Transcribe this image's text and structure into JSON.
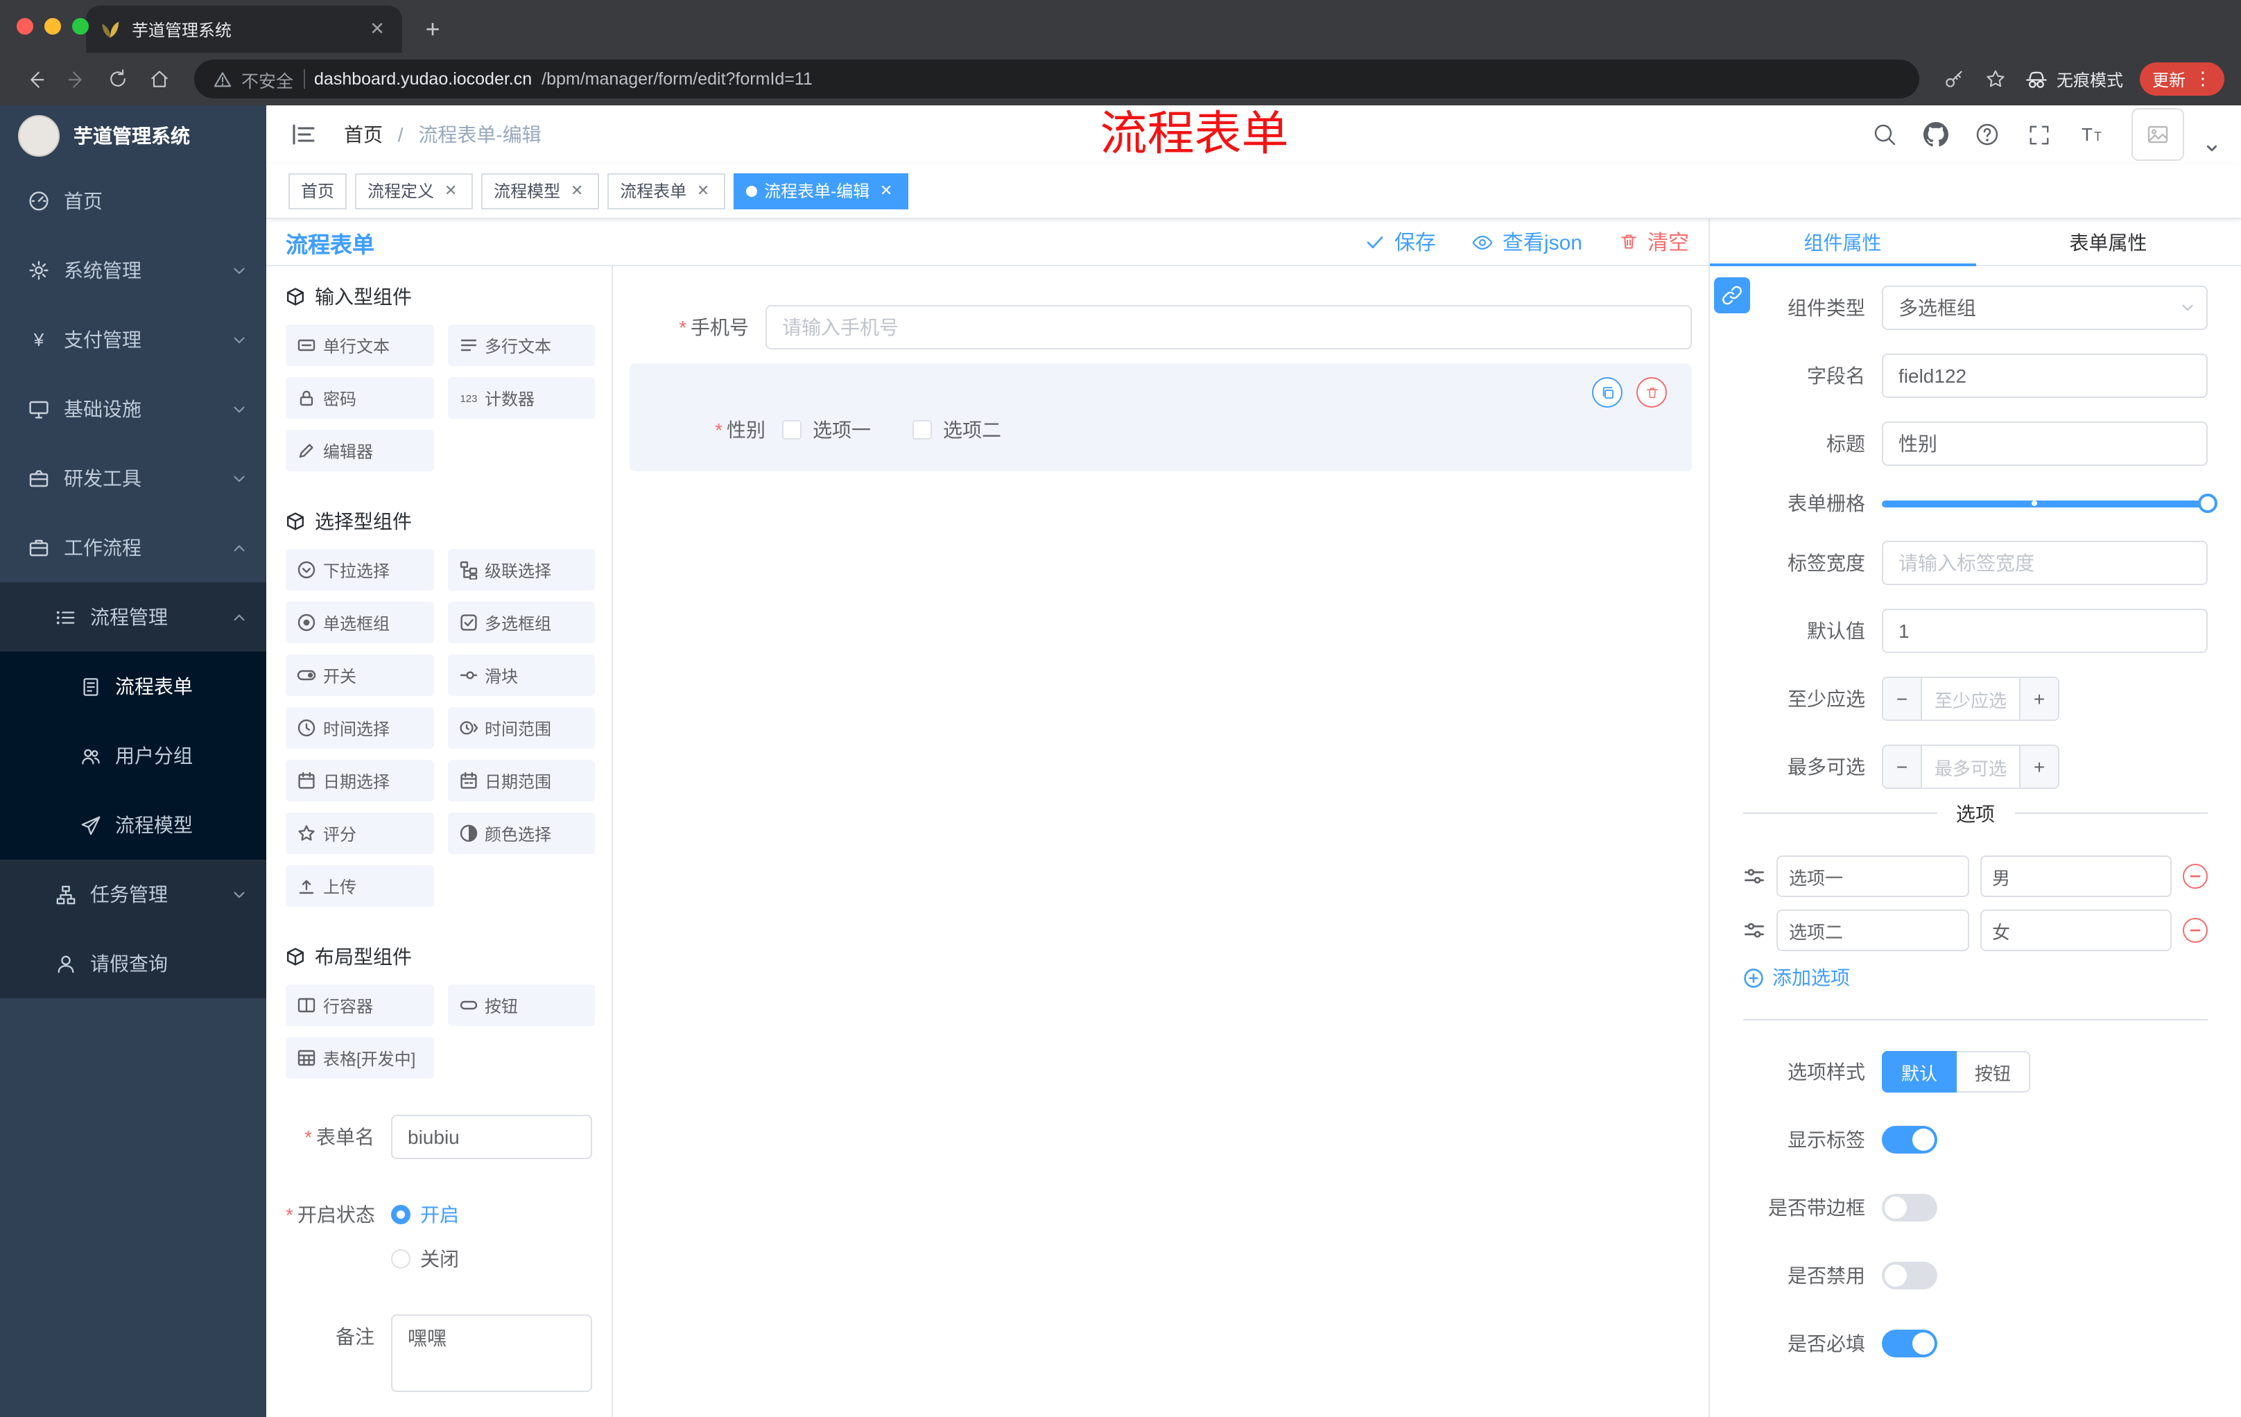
{
  "browser": {
    "tab_title": "芋道管理系统",
    "security_label": "不安全",
    "url_domain": "dashboard.yudao.iocoder.cn",
    "url_path": "/bpm/manager/form/edit?formId=11",
    "incognito_label": "无痕模式",
    "update_label": "更新"
  },
  "sidebar": {
    "logo_title": "芋道管理系统",
    "items": [
      {
        "label": "首页",
        "icon": "dashboard-icon"
      },
      {
        "label": "系统管理",
        "icon": "gear-icon"
      },
      {
        "label": "支付管理",
        "icon": "yen-icon"
      },
      {
        "label": "基础设施",
        "icon": "monitor-icon"
      },
      {
        "label": "研发工具",
        "icon": "toolbox-icon"
      },
      {
        "label": "工作流程",
        "icon": "briefcase-icon"
      },
      {
        "label": "流程管理",
        "icon": "list-icon"
      },
      {
        "label": "流程表单",
        "icon": "document-icon"
      },
      {
        "label": "用户分组",
        "icon": "users-icon"
      },
      {
        "label": "流程模型",
        "icon": "send-icon"
      },
      {
        "label": "任务管理",
        "icon": "tree-icon"
      },
      {
        "label": "请假查询",
        "icon": "user-icon"
      }
    ]
  },
  "navbar": {
    "breadcrumb_home": "首页",
    "breadcrumb_sep": "/",
    "breadcrumb_current": "流程表单-编辑",
    "annotation": "流程表单"
  },
  "tags": [
    {
      "label": "首页"
    },
    {
      "label": "流程定义"
    },
    {
      "label": "流程模型"
    },
    {
      "label": "流程表单"
    },
    {
      "label": "流程表单-编辑"
    }
  ],
  "designer": {
    "title": "流程表单",
    "save": "保存",
    "view_json": "查看json",
    "clear": "清空",
    "palette": {
      "section_input": "输入型组件",
      "input_items": [
        "单行文本",
        "多行文本",
        "密码",
        "计数器",
        "编辑器"
      ],
      "section_select": "选择型组件",
      "select_items": [
        "下拉选择",
        "级联选择",
        "单选框组",
        "多选框组",
        "开关",
        "滑块",
        "时间选择",
        "时间范围",
        "日期选择",
        "日期范围",
        "评分",
        "颜色选择",
        "上传"
      ],
      "section_layout": "布局型组件",
      "layout_items": [
        "行容器",
        "按钮",
        "表格[开发中]"
      ]
    },
    "meta": {
      "form_name_label": "表单名",
      "form_name_value": "biubiu",
      "status_label": "开启状态",
      "status_on": "开启",
      "status_off": "关闭",
      "remark_label": "备注",
      "remark_value": "嘿嘿"
    },
    "canvas": {
      "phone_label": "手机号",
      "phone_placeholder": "请输入手机号",
      "gender_label": "性别",
      "gender_option1": "选项一",
      "gender_option2": "选项二"
    }
  },
  "props": {
    "tab_component": "组件属性",
    "tab_form": "表单属性",
    "rows": {
      "type_label": "组件类型",
      "type_value": "多选框组",
      "field_label": "字段名",
      "field_value": "field122",
      "title_label": "标题",
      "title_value": "性别",
      "grid_label": "表单栅格",
      "width_label": "标签宽度",
      "width_placeholder": "请输入标签宽度",
      "default_label": "默认值",
      "default_value": "1",
      "min_label": "至少应选",
      "min_placeholder": "至少应选",
      "max_label": "最多可选",
      "max_placeholder": "最多可选"
    },
    "options": {
      "divider": "选项",
      "row1_label": "选项一",
      "row1_value": "男",
      "row2_label": "选项二",
      "row2_value": "女",
      "add": "添加选项"
    },
    "style": {
      "label": "选项样式",
      "opt_default": "默认",
      "opt_button": "按钮"
    },
    "switches": {
      "show_label": "显示标签",
      "border_label": "是否带边框",
      "disabled_label": "是否禁用",
      "required_label": "是否必填"
    }
  },
  "colors": {
    "accent": "#409eff",
    "danger": "#f56c6c",
    "annotation_red": "#f21313",
    "update_badge": "#d9453a",
    "sidebar_bg": "#304156",
    "sidebar_sub_bg": "#1f2d3d",
    "sidebar_sub2_bg": "#001528"
  }
}
